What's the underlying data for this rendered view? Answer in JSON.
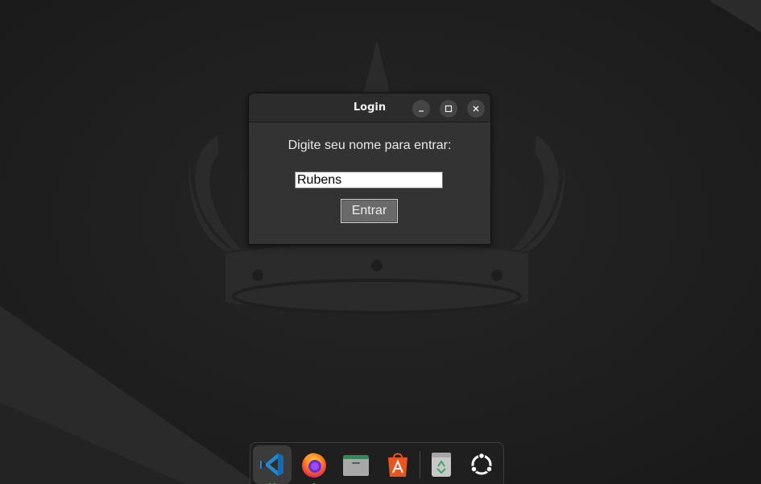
{
  "window": {
    "title": "Login",
    "controls": {
      "minimize": "minimize-icon",
      "maximize": "maximize-icon",
      "close": "close-icon"
    }
  },
  "form": {
    "prompt": "Digite seu nome para entrar:",
    "name_value": "Rubens",
    "enter_label": "Entrar"
  },
  "dock": {
    "items": [
      {
        "icon": "vscode-icon",
        "running": true,
        "running_count": 2,
        "active": true
      },
      {
        "icon": "firefox-icon",
        "running": true,
        "running_count": 1,
        "active": false
      },
      {
        "icon": "files-icon",
        "running": false,
        "active": false
      },
      {
        "icon": "app-center-icon",
        "running": false,
        "active": false
      },
      {
        "icon": "trash-icon",
        "running": false,
        "active": false
      },
      {
        "icon": "show-apps-icon",
        "running": false,
        "active": false
      }
    ]
  },
  "colors": {
    "desktop_bg": "#1e1e1e",
    "window_bg": "#333333",
    "titlebar_bg": "#2c2c2c",
    "button_bg": "#6a6a6a",
    "running_indicator": "#3fa66b",
    "vscode_blue": "#1f8ad2",
    "firefox_orange": "#ff7a1c",
    "app_center_orange": "#e95420"
  }
}
